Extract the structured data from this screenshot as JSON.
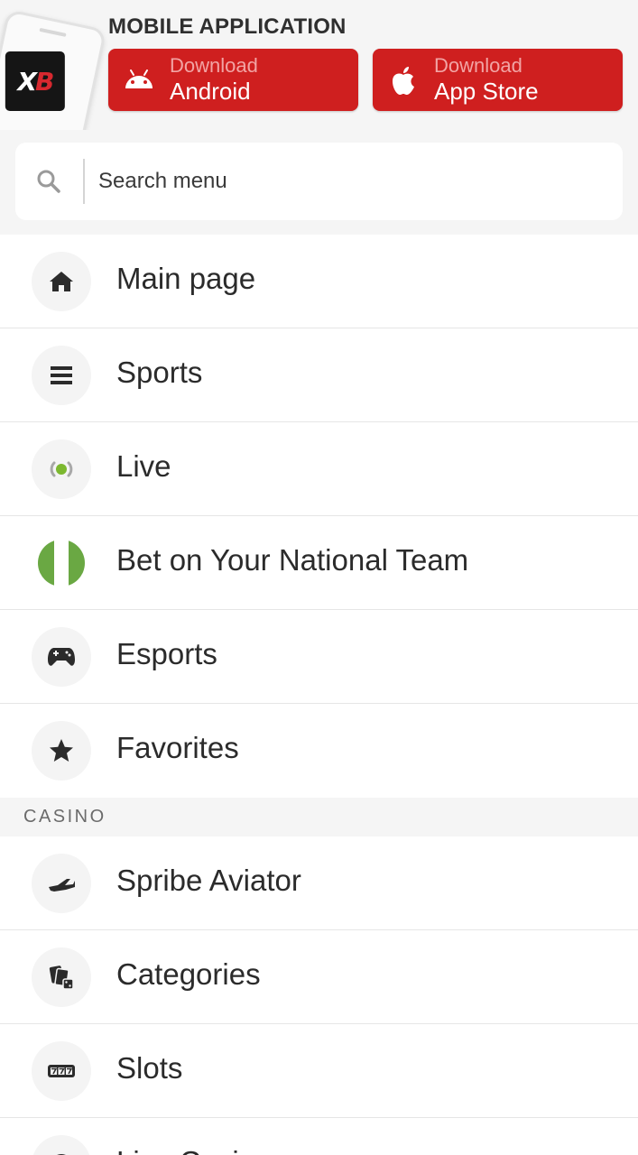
{
  "banner": {
    "title": "MOBILE APPLICATION",
    "logo_left": "X",
    "logo_right": "B",
    "android": {
      "small": "Download",
      "big": "Android",
      "icon": "android-icon"
    },
    "ios": {
      "small": "Download",
      "big": "App Store",
      "icon": "apple-icon"
    },
    "accent_color": "#cf1f1f"
  },
  "search": {
    "placeholder": "Search menu",
    "value": "",
    "icon": "search-icon"
  },
  "menu": {
    "items": [
      {
        "label": "Main page",
        "icon": "home-icon"
      },
      {
        "label": "Sports",
        "icon": "list-icon"
      },
      {
        "label": "Live",
        "icon": "live-broadcast-icon"
      },
      {
        "label": "Bet on Your National Team",
        "icon": "nigeria-flag-icon"
      },
      {
        "label": "Esports",
        "icon": "gamepad-icon"
      },
      {
        "label": "Favorites",
        "icon": "star-icon"
      }
    ]
  },
  "casino": {
    "header": "CASINO",
    "items": [
      {
        "label": "Spribe Aviator",
        "icon": "airplane-icon"
      },
      {
        "label": "Categories",
        "icon": "cards-dice-icon"
      },
      {
        "label": "Slots",
        "icon": "slot-777-icon"
      },
      {
        "label": "Live Casino",
        "icon": "live-casino-icon"
      }
    ]
  }
}
